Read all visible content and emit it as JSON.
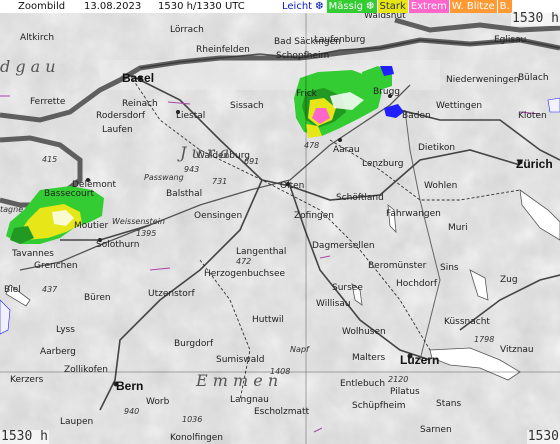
{
  "header": {
    "zoom_label": "Zoombild",
    "date": "13.08.2023",
    "time": "1530 h/1330 UTC",
    "legend": [
      {
        "label": "Leicht ❆",
        "color": "#ffffff"
      },
      {
        "label": "Mässig ❆",
        "color": "#33cc33"
      },
      {
        "label": "Stark",
        "color": "#e6e619"
      },
      {
        "label": "Extrem",
        "color": "#ff66cc"
      },
      {
        "label": "W. Blitze",
        "color": "#ff9933"
      },
      {
        "label": "B.",
        "color": "#ff9933"
      }
    ]
  },
  "time_stamps": {
    "top_right": "1530 h",
    "bottom_left": "1530 h",
    "bottom_right": "1530"
  },
  "cities": {
    "basel": "Basel",
    "liestal": "Liestal",
    "delemont": "Delémont",
    "solothurn": "Solothurn",
    "grenchen": "Grenchen",
    "biel": "Biel",
    "bern": "Bern",
    "olten": "Olten",
    "aarau": "Aarau",
    "brugg": "Brugg",
    "baden": "Baden",
    "zurich": "Zürich",
    "luzern": "Luzern",
    "zofingen": "Zofingen",
    "langenthal": "Langenthal",
    "burgdorf": "Burgdorf",
    "sursee": "Sursee",
    "lenzburg": "Lenzburg",
    "wettingen": "Wettingen",
    "dietikon": "Dietikon",
    "frick": "Frick",
    "reinach": "Reinach",
    "lorrach": "Lörrach",
    "rheinfelden": "Rheinfelden",
    "bad_sackingen": "Bad Säckingen",
    "laufenburg": "Laufenburg",
    "waldshut": "Waldshut",
    "kloten": "Kloten",
    "bulach": "Bülach",
    "willisau": "Willisau",
    "wolhusen": "Wolhusen",
    "entlebuch": "Entlebuch",
    "huttwil": "Huttwil",
    "sumiswald": "Sumiswald",
    "langnau": "Langnau",
    "worb": "Worb",
    "konolfingen": "Konolfingen",
    "laupen": "Laupen",
    "kerzers": "Kerzers",
    "aarberg": "Aarberg",
    "lyss": "Lyss",
    "buren": "Büren",
    "herzogenbuchsee": "Herzogenbuchsee",
    "balsthal": "Balsthal",
    "oensingen": "Oensingen",
    "laufen": "Laufen",
    "sissach": "Sissach",
    "wohlen": "Wohlen",
    "sins": "Sins",
    "zug": "Zug",
    "kussnacht": "Küssnacht",
    "vitznau": "Vitznau",
    "stans": "Stans",
    "malters": "Malters",
    "sarnen": "Sarnen",
    "muri": "Muri",
    "altkirch": "Altkirch",
    "ferrette": "Ferrette",
    "bassecourt": "Bassecourt",
    "tavannes": "Tavannes",
    "moutier": "Moutier",
    "waldenburg": "Waldenburg",
    "passwang": "Passwang",
    "weissenstein": "Weissenstein",
    "schopfheim": "Schopfheim",
    "niederweningen": "Niederweningen",
    "eglisau": "Eglisau",
    "schoftland": "Schöftland",
    "fahrwangen": "Fahrwangen",
    "beromunster": "Beromünster",
    "dagmersellen": "Dagmersellen",
    "schupfheim": "Schüpfheim",
    "escholzmatt": "Escholzmatt",
    "pilatus": "Pilatus",
    "rodersdorf": "Rodersdorf",
    "zollikofen": "Zollikofen",
    "hochdorf": "Hochdorf",
    "napf": "Napf",
    "utzenstorf": "Utzenstorf"
  },
  "regions": {
    "jura": "J u r a",
    "emmental": "E m m e n",
    "gau": "d g a u",
    "tagne": "tagne"
  },
  "numbers": [
    "943",
    "691",
    "731",
    "1395",
    "1408",
    "1798",
    "2120",
    "437",
    "415",
    "472",
    "940",
    "1036",
    "478"
  ],
  "precip_colors": {
    "light": "#f2f2ff",
    "moderate": "#33cc33",
    "moderate_dark": "#229922",
    "strong": "#e6e619",
    "extreme": "#ff66cc",
    "blue": "#2020ff"
  }
}
